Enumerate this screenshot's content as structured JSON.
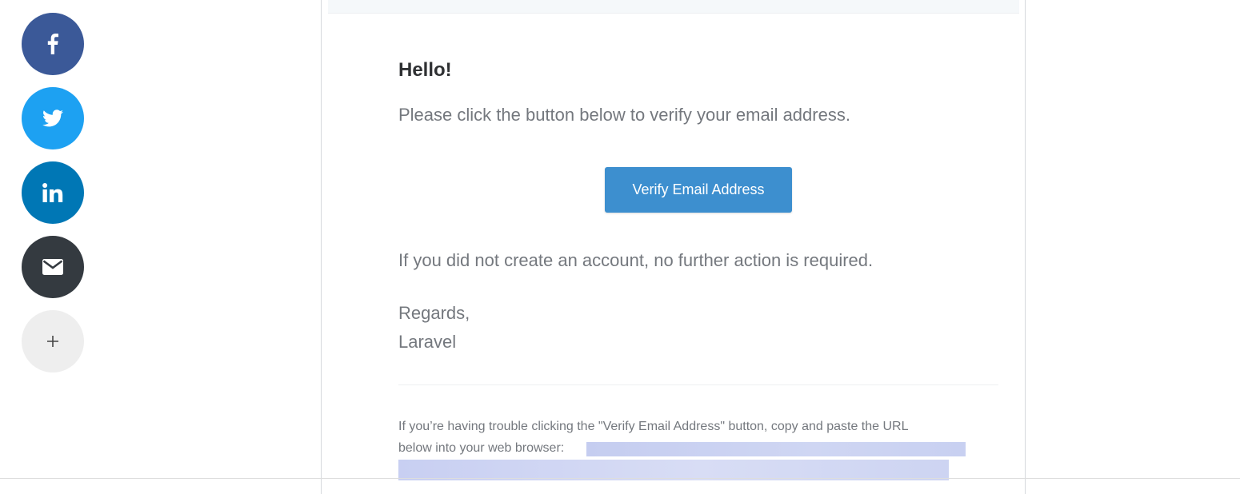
{
  "share": {
    "items": [
      {
        "icon": "facebook-icon",
        "color": "#3b5998"
      },
      {
        "icon": "twitter-icon",
        "color": "#1da1f2"
      },
      {
        "icon": "linkedin-icon",
        "color": "#0077b5"
      },
      {
        "icon": "envelope-icon",
        "color": "#343a40"
      },
      {
        "icon": "plus-icon",
        "color": "#eeeeee"
      }
    ]
  },
  "email": {
    "greeting": "Hello!",
    "intro": "Please click the button below to verify your email address.",
    "button_label": "Verify Email Address",
    "button_color": "#3d8fcf",
    "outro": "If you did not create an account, no further action is required.",
    "salutation": "Regards,",
    "sender": "Laravel",
    "subcopy_line1": "If you’re having trouble clicking the \"Verify Email Address\" button, copy and paste the URL",
    "subcopy_line2": "below into your web browser:"
  }
}
